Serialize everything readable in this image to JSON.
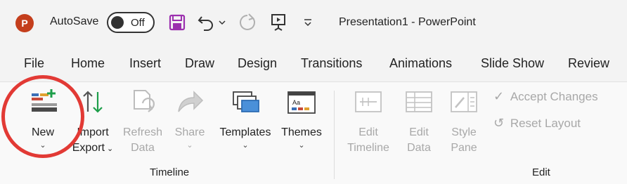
{
  "titlebar": {
    "app_logo_letter": "P",
    "autosave_label": "AutoSave",
    "autosave_state": "Off",
    "document_title": "Presentation1  -  PowerPoint"
  },
  "tabs": [
    "File",
    "Home",
    "Insert",
    "Draw",
    "Design",
    "Transitions",
    "Animations",
    "Slide Show",
    "Review"
  ],
  "ribbon": {
    "timeline_group": {
      "label": "Timeline",
      "new": "New",
      "import": "Import",
      "export": "Export",
      "refresh_1": "Refresh",
      "refresh_2": "Data",
      "share": "Share",
      "templates": "Templates",
      "themes": "Themes"
    },
    "edit_group": {
      "label": "Edit",
      "edit_timeline_1": "Edit",
      "edit_timeline_2": "Timeline",
      "edit_data_1": "Edit",
      "edit_data_2": "Data",
      "style_pane_1": "Style",
      "style_pane_2": "Pane",
      "accept_changes": "Accept Changes",
      "reset_layout": "Reset Layout"
    }
  },
  "colors": {
    "accent_red": "#e23a35",
    "powerpoint_orange": "#c43e1c",
    "disabled_text": "#a8a8a8"
  }
}
